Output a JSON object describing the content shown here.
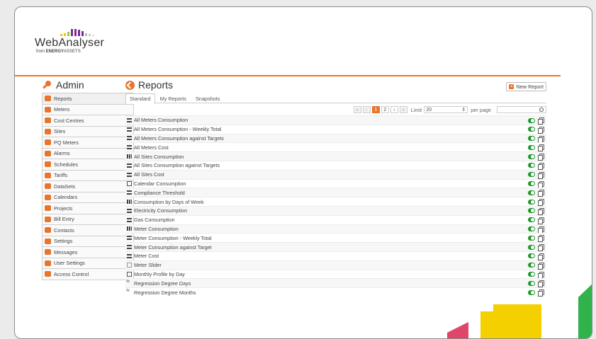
{
  "brand": {
    "name": "WebAnalyser",
    "sub_prefix": "from",
    "sub_company_bold": "ENERGY",
    "sub_company_rest": "ASSETS"
  },
  "admin": {
    "title": "Admin",
    "items": [
      {
        "label": "Reports",
        "icon": "pie-chart-icon",
        "color": "#e8752b"
      },
      {
        "label": "Meters",
        "icon": "meter-icon",
        "color": "#e8752b"
      },
      {
        "label": "Cost Centres",
        "icon": "cost-icon",
        "color": "#e8752b"
      },
      {
        "label": "Sites",
        "icon": "sites-icon",
        "color": "#e8752b"
      },
      {
        "label": "PQ Meters",
        "icon": "pq-icon",
        "color": "#e8752b"
      },
      {
        "label": "Alarms",
        "icon": "alarm-icon",
        "color": "#e8752b"
      },
      {
        "label": "Schedules",
        "icon": "schedule-icon",
        "color": "#e8752b"
      },
      {
        "label": "Tariffs",
        "icon": "tariff-icon",
        "color": "#e8752b"
      },
      {
        "label": "DataSets",
        "icon": "dataset-icon",
        "color": "#e8752b"
      },
      {
        "label": "Calendars",
        "icon": "calendar-icon",
        "color": "#e8752b"
      },
      {
        "label": "Projects",
        "icon": "project-icon",
        "color": "#e8752b"
      },
      {
        "label": "Bill Entry",
        "icon": "bill-icon",
        "color": "#e8752b"
      },
      {
        "label": "Contacts",
        "icon": "contacts-icon",
        "color": "#e8752b"
      },
      {
        "label": "Settings",
        "icon": "settings-icon",
        "color": "#e8752b"
      },
      {
        "label": "Messages",
        "icon": "messages-icon",
        "color": "#e8752b"
      },
      {
        "label": "User Settings",
        "icon": "user-settings-icon",
        "color": "#e8752b"
      },
      {
        "label": "Access Control",
        "icon": "access-icon",
        "color": "#e8752b"
      }
    ]
  },
  "reports": {
    "title": "Reports",
    "new_button": "New Report",
    "tabs": [
      "Standard",
      "My Reports",
      "Snapshots"
    ],
    "pager": {
      "current": "1",
      "next": "2",
      "limit_label": "Limit",
      "limit_value": "20",
      "per_page": "per page"
    },
    "rows": [
      {
        "name": "All Meters Consumption",
        "icon": "table"
      },
      {
        "name": "All Meters Consumption - Weekly Total",
        "icon": "table"
      },
      {
        "name": "All Meters Consumption against Targets",
        "icon": "table"
      },
      {
        "name": "All Meters Cost",
        "icon": "table"
      },
      {
        "name": "All Sites Consumption",
        "icon": "bars"
      },
      {
        "name": "All Sites Consumption against Targets",
        "icon": "table"
      },
      {
        "name": "All Sites Cost",
        "icon": "table"
      },
      {
        "name": "Calendar Consumption",
        "icon": "cal"
      },
      {
        "name": "Compliance Threshold",
        "icon": "table"
      },
      {
        "name": "Consumption by Days of Week",
        "icon": "bars"
      },
      {
        "name": "Electricity Consumption",
        "icon": "table"
      },
      {
        "name": "Gas Consumption",
        "icon": "table"
      },
      {
        "name": "Meter Consumption",
        "icon": "bars"
      },
      {
        "name": "Meter Consumption - Weekly Total",
        "icon": "table"
      },
      {
        "name": "Meter Consumption against Target",
        "icon": "table"
      },
      {
        "name": "Meter Cost",
        "icon": "table"
      },
      {
        "name": "Meter Slider",
        "icon": "slide"
      },
      {
        "name": "Monthly Profile by Day",
        "icon": "cal"
      },
      {
        "name": "Regression Degree Days",
        "icon": "reg"
      },
      {
        "name": "Regression Degree Months",
        "icon": "reg"
      }
    ]
  },
  "colors": {
    "accent": "#e8752b",
    "toggle": "#1a9a2a",
    "deco_yellow": "#f5d000",
    "deco_green": "#2fb34a",
    "deco_pink": "#e0456a"
  }
}
